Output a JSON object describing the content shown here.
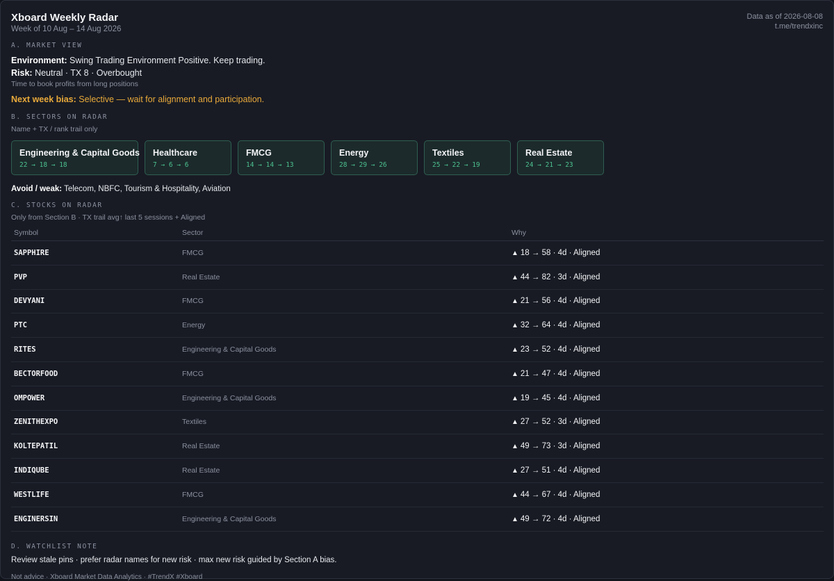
{
  "header": {
    "title": "Xboard Weekly Radar",
    "subtitle": "Week of 10 Aug – 14 Aug 2026",
    "data_as_of": "Data as of 2026-08-08",
    "channel": "t.me/trendxinc"
  },
  "market_view": {
    "label": "A. MARKET VIEW",
    "environment_label": "Environment:",
    "environment_value": "Swing Trading Environment Positive. Keep trading.",
    "risk_label": "Risk:",
    "risk_value": "Neutral · TX 8 · Overbought",
    "note": "Time to book profits from long positions",
    "bias_label": "Next week bias:",
    "bias_value": "Selective — wait for alignment and participation."
  },
  "sectors": {
    "label": "B. SECTORS ON RADAR",
    "note": "Name + TX / rank trail only",
    "cards": [
      {
        "name": "Engineering & Capital Goods",
        "trail": "22 → 18 → 18"
      },
      {
        "name": "Healthcare",
        "trail": "7 → 6 → 6"
      },
      {
        "name": "FMCG",
        "trail": "14 → 14 → 13"
      },
      {
        "name": "Energy",
        "trail": "28 → 29 → 26"
      },
      {
        "name": "Textiles",
        "trail": "25 → 22 → 19"
      },
      {
        "name": "Real Estate",
        "trail": "24 → 21 → 23"
      }
    ],
    "avoid_label": "Avoid / weak:",
    "avoid_value": "Telecom, NBFC, Tourism & Hospitality, Aviation"
  },
  "stocks": {
    "label": "C. STOCKS ON RADAR",
    "note": "Only from Section B · TX trail avg↑ last 5 sessions + Aligned",
    "columns": {
      "symbol": "Symbol",
      "sector": "Sector",
      "why": "Why"
    },
    "trend_icon": "triangle-up-icon",
    "rows": [
      {
        "symbol": "SAPPHIRE",
        "sector": "FMCG",
        "why": "18 → 58 · 4d · Aligned"
      },
      {
        "symbol": "PVP",
        "sector": "Real Estate",
        "why": "44 → 82 · 3d · Aligned"
      },
      {
        "symbol": "DEVYANI",
        "sector": "FMCG",
        "why": "21 → 56 · 4d · Aligned"
      },
      {
        "symbol": "PTC",
        "sector": "Energy",
        "why": "32 → 64 · 4d · Aligned"
      },
      {
        "symbol": "RITES",
        "sector": "Engineering & Capital Goods",
        "why": "23 → 52 · 4d · Aligned"
      },
      {
        "symbol": "BECTORFOOD",
        "sector": "FMCG",
        "why": "21 → 47 · 4d · Aligned"
      },
      {
        "symbol": "OMPOWER",
        "sector": "Engineering & Capital Goods",
        "why": "19 → 45 · 4d · Aligned"
      },
      {
        "symbol": "ZENITHEXPO",
        "sector": "Textiles",
        "why": "27 → 52 · 3d · Aligned"
      },
      {
        "symbol": "KOLTEPATIL",
        "sector": "Real Estate",
        "why": "49 → 73 · 3d · Aligned"
      },
      {
        "symbol": "INDIQUBE",
        "sector": "Real Estate",
        "why": "27 → 51 · 4d · Aligned"
      },
      {
        "symbol": "WESTLIFE",
        "sector": "FMCG",
        "why": "44 → 67 · 4d · Aligned"
      },
      {
        "symbol": "ENGINERSIN",
        "sector": "Engineering & Capital Goods",
        "why": "49 → 72 · 4d · Aligned"
      }
    ]
  },
  "watchlist": {
    "label": "D. WATCHLIST NOTE",
    "text": "Review stale pins · prefer radar names for new risk · max new risk guided by Section A bias."
  },
  "footer": "Not advice · Xboard Market Data Analytics · #TrendX #Xboard",
  "colors": {
    "accent_green": "#4cc08f",
    "bias_amber": "#e8a93a",
    "card_border": "#2f5f51"
  }
}
